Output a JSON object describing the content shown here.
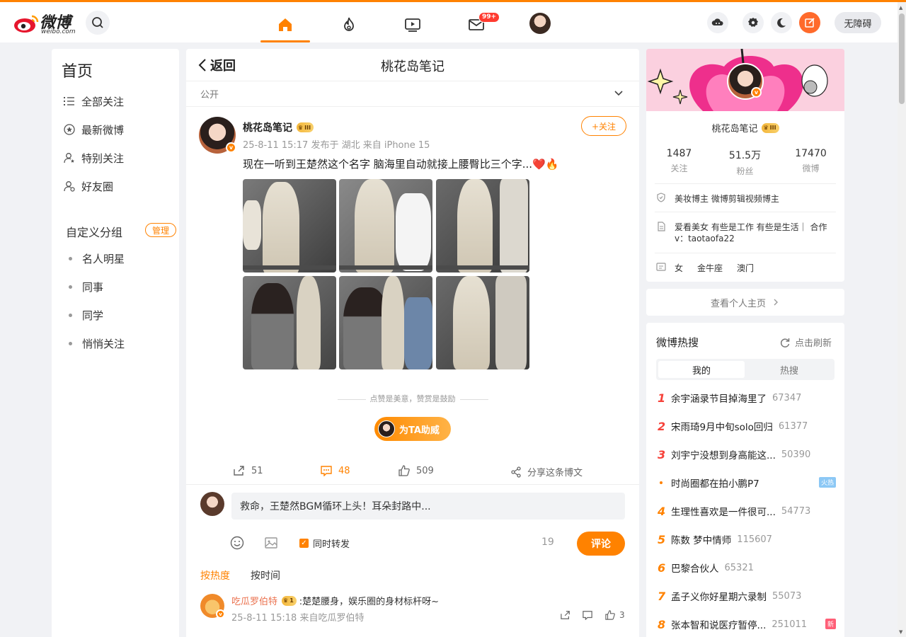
{
  "brand": {
    "name": "微博",
    "url": "weibo.com"
  },
  "nav": {
    "mail_badge": "99+"
  },
  "header": {
    "accessibility": "无障碍"
  },
  "left": {
    "title": "首页",
    "items": [
      {
        "label": "全部关注",
        "icon": "list-icon"
      },
      {
        "label": "最新微博",
        "icon": "star-circle-icon"
      },
      {
        "label": "特别关注",
        "icon": "user-star-icon"
      },
      {
        "label": "好友圈",
        "icon": "user-group-icon"
      }
    ],
    "group_title": "自定义分组",
    "manage": "管理",
    "groups": [
      "名人明星",
      "同事",
      "同学",
      "悄悄关注"
    ]
  },
  "main": {
    "back": "返回",
    "title": "桃花岛笔记",
    "visibility": "公开",
    "post": {
      "author": "桃花岛笔记",
      "level": "III",
      "meta": "25-8-11 15:17 发布于 湖北 来自 iPhone 15",
      "follow": "+关注",
      "text": "现在一听到王楚然这个名字 脑海里自动就接上腰臀比三个字...",
      "emoji": "❤️🔥"
    },
    "encourage": "点赞是美意，赞赏是鼓励",
    "boost": "为TA助威",
    "actions": {
      "repost": "51",
      "comment": "48",
      "like": "509",
      "share": "分享这条博文"
    },
    "composer": {
      "text": "救命，王楚然BGM循环上头！耳朵封路中...",
      "repost_label": "同时转发",
      "count": "19",
      "send": "评论"
    },
    "sort": {
      "hot": "按热度",
      "time": "按时间"
    },
    "comment1": {
      "name": "吃瓜罗伯特",
      "level": "1",
      "text": ":楚楚腰身，娱乐圈的身材标杆呀~",
      "meta": "25-8-11 15:18 来自吃瓜罗伯特",
      "likes": "3"
    }
  },
  "profile": {
    "name": "桃花岛笔记",
    "level": "III",
    "stats": [
      {
        "num": "1487",
        "label": "关注"
      },
      {
        "num": "51.5万",
        "label": "粉丝"
      },
      {
        "num": "17470",
        "label": "微博"
      }
    ],
    "tag": "美妆博主 微博剪辑视频博主",
    "bio": "爱看美女 有些是工作 有些是生活｜ 合作v：taotaofa22",
    "gender": "女",
    "zodiac": "金牛座",
    "location": "澳门",
    "view_home": "查看个人主页"
  },
  "hot": {
    "title": "微博热搜",
    "refresh": "点击刷新",
    "tabs": [
      "我的",
      "热搜"
    ],
    "items": [
      {
        "rank": "1",
        "text": "余宇涵录节目掉海里了",
        "count": "67347",
        "tag": ""
      },
      {
        "rank": "2",
        "text": "宋雨琦9月中旬solo回归",
        "count": "61377",
        "tag": ""
      },
      {
        "rank": "3",
        "text": "刘宇宁没想到身高能这...",
        "count": "50390",
        "tag": ""
      },
      {
        "rank": "•",
        "text": "时尚圈都在拍小鹏P7",
        "count": "",
        "tag": "火热"
      },
      {
        "rank": "4",
        "text": "生理性喜欢是一件很可...",
        "count": "54773",
        "tag": ""
      },
      {
        "rank": "5",
        "text": "陈数 梦中情师",
        "count": "115607",
        "tag": ""
      },
      {
        "rank": "6",
        "text": "巴黎合伙人",
        "count": "65321",
        "tag": ""
      },
      {
        "rank": "7",
        "text": "孟子义你好星期六录制",
        "count": "55073",
        "tag": ""
      },
      {
        "rank": "8",
        "text": "张本智和说医疗暂停...",
        "count": "251011",
        "tag": "新"
      }
    ]
  },
  "colors": {
    "accent": "#ff8200",
    "hot_red": "#f6423a",
    "tag_blue": "#8cc8f5",
    "tag_new": "#ff5f77"
  }
}
